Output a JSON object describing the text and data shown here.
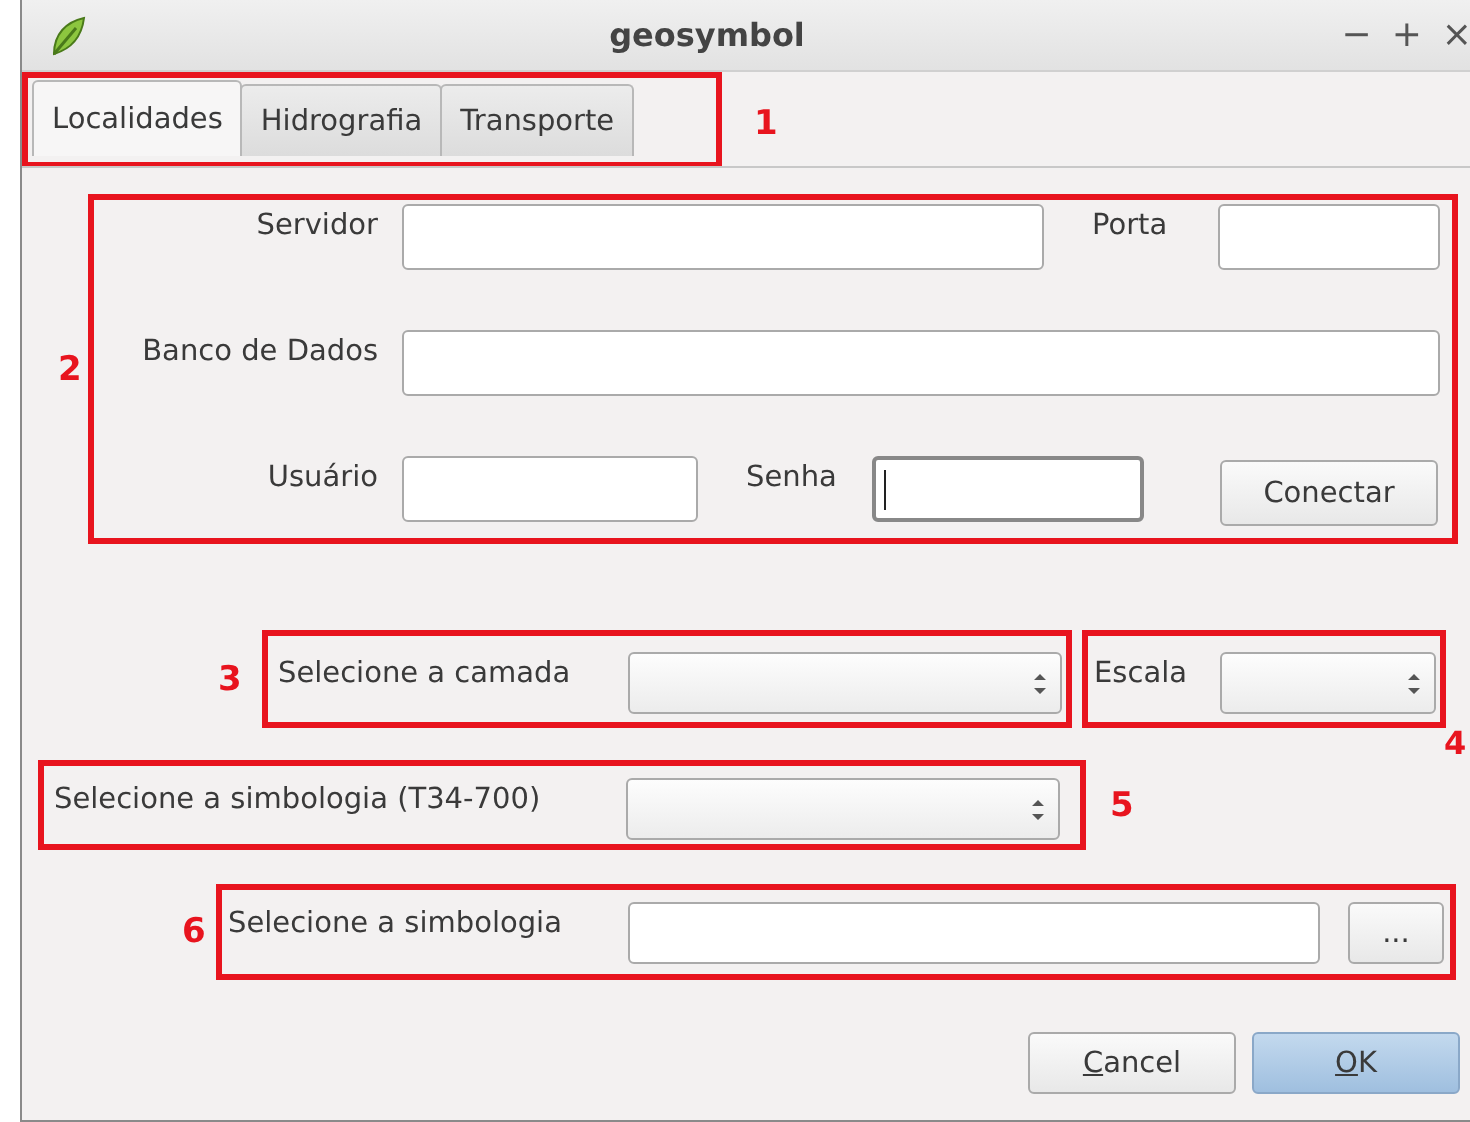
{
  "window": {
    "title": "geosymbol",
    "controls": [
      "−",
      "+",
      "×"
    ]
  },
  "tabs": [
    {
      "label": "Localidades",
      "selected": true
    },
    {
      "label": "Hidrografia",
      "selected": false
    },
    {
      "label": "Transporte",
      "selected": false
    }
  ],
  "tabs_annotation": "1",
  "connection": {
    "annotation": "2",
    "rows": [
      [
        {
          "label": "Servidor",
          "focused": false
        },
        {
          "label": "Porta",
          "focused": false
        }
      ],
      [
        {
          "label": "Banco de Dados",
          "focused": false
        }
      ],
      [
        {
          "label": "Usuário",
          "focused": false
        },
        {
          "label": "Senha",
          "focused": true
        }
      ]
    ],
    "button": "Conectar"
  },
  "layer": {
    "annotation": "3",
    "label": "Selecione a camada"
  },
  "scale": {
    "annotation": "4",
    "label": "Escala"
  },
  "symbology_code": {
    "annotation": "5",
    "label": "Selecione a simbologia (T34-700)"
  },
  "symbology_file": {
    "annotation": "6",
    "label": "Selecione a simbologia",
    "browse_button": "..."
  },
  "buttons": [
    {
      "label": "Cancel",
      "default": false,
      "mnemonic_first": true
    },
    {
      "label": "OK",
      "default": true,
      "mnemonic_first": true
    }
  ]
}
